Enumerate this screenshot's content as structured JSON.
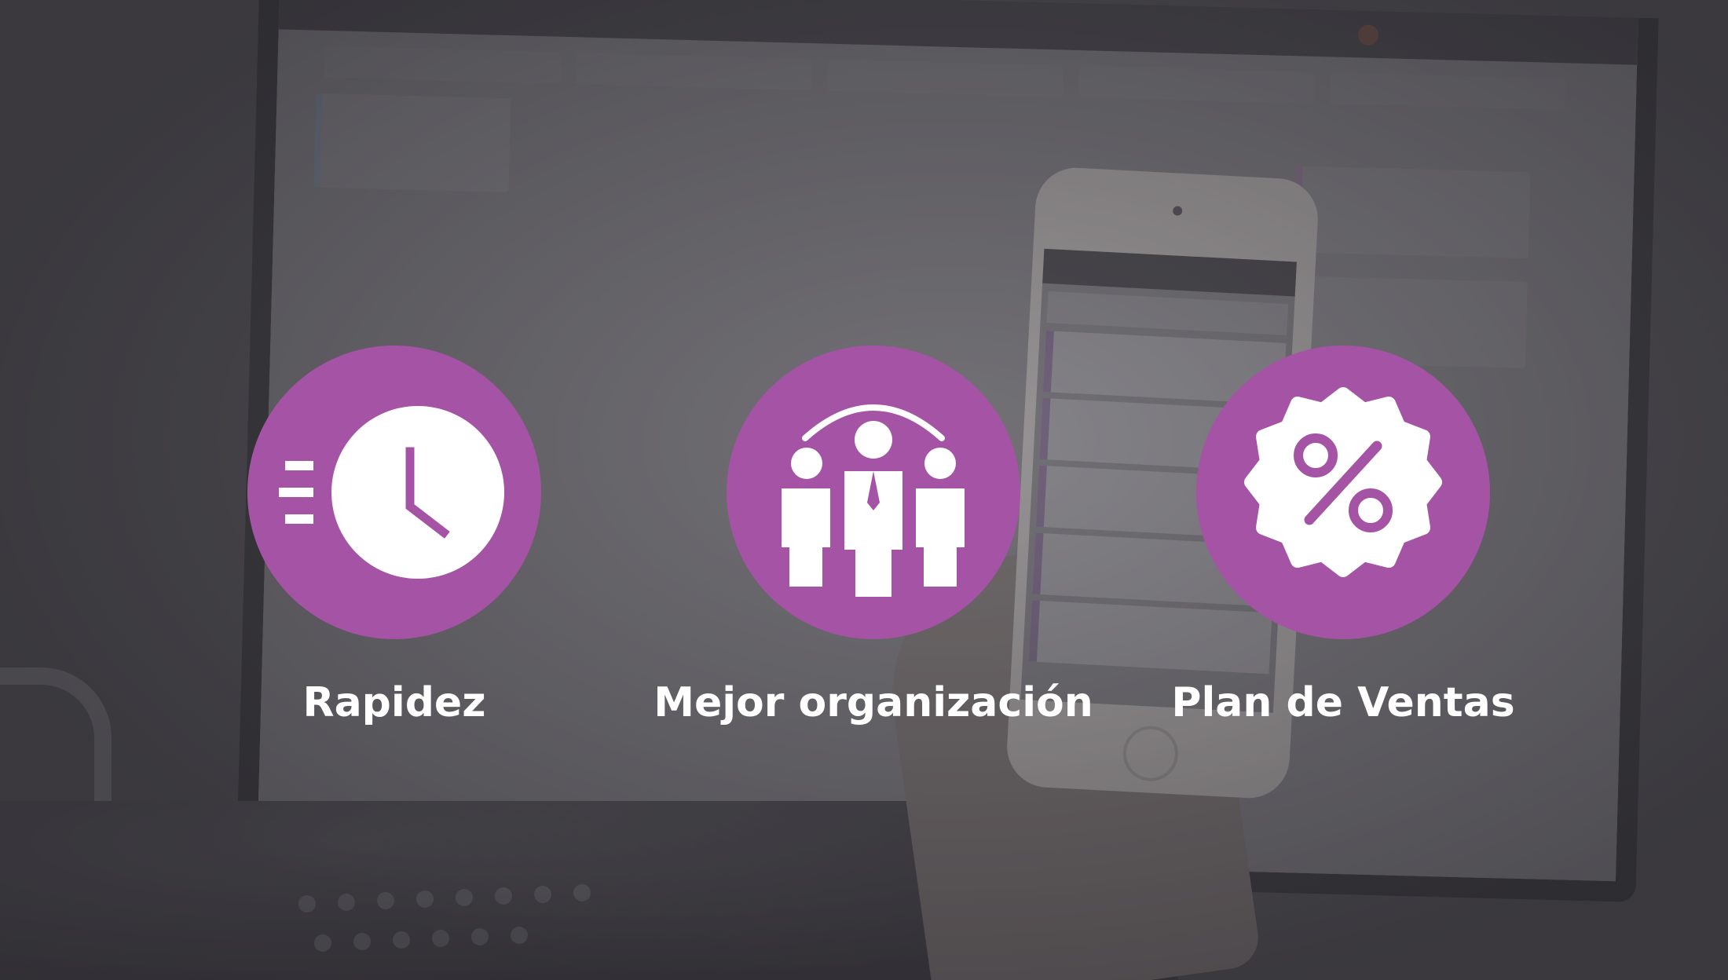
{
  "features": [
    {
      "label": "Rapidez",
      "icon": "fast-clock-icon"
    },
    {
      "label": "Mejor organización",
      "icon": "team-icon"
    },
    {
      "label": "Plan de Ventas",
      "icon": "percent-badge-icon"
    }
  ],
  "colors": {
    "accent": "#a553a4",
    "label": "#ffffff",
    "overlay": "#4f4d52"
  }
}
